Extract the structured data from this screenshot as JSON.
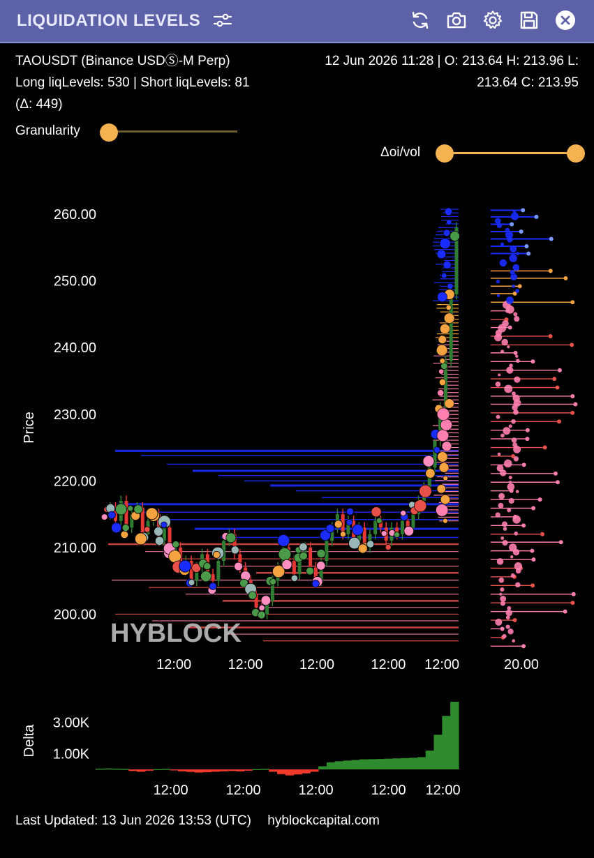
{
  "header": {
    "title": "LIQUIDATION LEVELS",
    "icons": [
      "sliders-icon",
      "refresh-icon",
      "camera-icon",
      "gear-icon",
      "save-icon",
      "close-icon"
    ]
  },
  "info": {
    "symbol_line": "TAOUSDT (Binance USDⓈ-M Perp)",
    "levels_line": "Long liqLevels: 530 | Short liqLevels: 81",
    "delta_line": "(Δ: 449)",
    "ohlc_line1": "12 Jun 2026 11:28 | O: 213.64 H: 213.96 L:",
    "ohlc_line2": "213.64 C: 213.95"
  },
  "controls": {
    "granularity_label": "Granularity",
    "granularity_value": 0.0,
    "doi_label": "Δoi/vol",
    "doi_range": [
      0.0,
      1.0
    ]
  },
  "colors": {
    "header_bg": "#5d62a8",
    "accent": "#f4b350",
    "candle_up": "#2e7d32",
    "candle_down": "#e53935",
    "long_liq": "#ff7fb0",
    "long_liq_strong": "#e8504a",
    "short_liq": "#1a2cff",
    "delta_pos": "#2e8b2e",
    "delta_neg": "#f03a2a"
  },
  "chart_data": [
    {
      "type": "line",
      "ylabel": "Price",
      "ylim": [
        194.5,
        262
      ],
      "yticks": [
        "260.00",
        "250.00",
        "240.00",
        "230.00",
        "220.00",
        "210.00",
        "200.00"
      ],
      "ytick_values": [
        260,
        250,
        240,
        230,
        220,
        210,
        200
      ],
      "xticks": [
        "12:00",
        "12:00",
        "12:00",
        "12:00",
        "12:00"
      ],
      "xtick_positions": [
        0.18,
        0.38,
        0.58,
        0.78,
        0.93
      ],
      "watermark": "HYBLOCK",
      "series": [
        {
          "values": [
            215,
            216,
            214,
            217,
            213,
            215,
            216,
            212,
            214,
            215,
            211,
            213,
            209,
            210,
            207,
            208,
            205,
            207,
            209,
            206,
            205,
            208,
            211,
            212,
            209,
            207,
            205,
            203,
            201,
            200,
            202,
            205,
            207,
            210,
            208,
            206,
            209,
            210,
            207,
            205,
            208,
            211,
            213,
            215,
            212,
            214,
            211,
            213,
            210,
            212,
            214,
            213,
            211,
            213,
            212,
            214,
            213,
            215,
            217,
            219,
            222,
            226,
            231,
            238,
            248,
            258
          ]
        }
      ],
      "liq_levels_short": [
        224.5,
        223.8,
        222.5,
        221.5,
        220.8,
        220.0,
        219.3,
        218.5,
        217.5,
        216.5,
        215.3,
        214.2,
        212.8,
        211.5
      ],
      "liq_levels_long": [
        210.5,
        209.4,
        208.3,
        207.2,
        206.2,
        205.1,
        204.0,
        203.0,
        202.0,
        201.0,
        200.0,
        199.0,
        198.0,
        197.0,
        196.0
      ]
    },
    {
      "type": "scatter",
      "xticks": [
        "20.00"
      ],
      "short_points": [
        260.6,
        259.6,
        258.5,
        257.4,
        256.3,
        255.2,
        254.1
      ],
      "mid_points": [
        251.5,
        250.4,
        249.2,
        248.1,
        246.8
      ],
      "long_points": [
        245.5,
        244.2,
        243.0,
        241.7,
        240.4,
        239.2,
        237.9,
        236.6,
        235.3,
        234.0,
        232.7,
        231.5,
        230.2,
        228.9,
        227.6,
        226.3,
        225.0,
        223.7,
        222.4,
        221.1,
        219.8,
        218.5,
        217.2,
        215.9,
        214.6,
        213.3,
        212.0,
        210.8,
        209.5,
        208.2,
        206.9,
        205.6,
        204.3,
        203.0,
        201.7,
        200.4,
        199.1,
        197.8,
        196.5,
        195.2
      ]
    },
    {
      "type": "area",
      "ylabel": "Delta",
      "yticks": [
        "3.00K",
        "1.00K"
      ],
      "ytick_values": [
        3000,
        1000
      ],
      "xticks": [
        "12:00",
        "12:00",
        "12:00",
        "12:00",
        "12:00"
      ],
      "xtick_positions": [
        0.18,
        0.38,
        0.58,
        0.78,
        0.93
      ],
      "values": [
        50,
        60,
        50,
        40,
        -100,
        -150,
        -80,
        20,
        40,
        -60,
        -120,
        -160,
        -200,
        -180,
        -150,
        -120,
        -100,
        -120,
        -80,
        20,
        40,
        -150,
        -300,
        -380,
        -320,
        -250,
        -150,
        200,
        450,
        520,
        560,
        600,
        640,
        650,
        660,
        680,
        700,
        720,
        740,
        780,
        1200,
        2200,
        3400,
        4300
      ]
    }
  ],
  "footer": {
    "last_updated": "Last Updated: 13 Jun 2026 13:53 (UTC)",
    "site": "hyblockcapital.com"
  }
}
